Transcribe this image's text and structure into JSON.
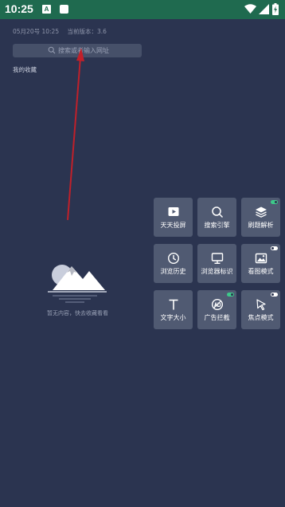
{
  "status_bar": {
    "time": "10:25",
    "notif_a": "A"
  },
  "header": {
    "date_time": "05月20号 10:25",
    "version_label": "当前版本：3.6"
  },
  "search": {
    "placeholder": "搜索或者输入网址"
  },
  "bookmarks": {
    "title": "我的收藏",
    "empty_text": "暂无内容，快去收藏看看"
  },
  "tiles": [
    {
      "label": "天天投屏",
      "icon": "cast-play-icon",
      "toggle": null
    },
    {
      "label": "搜索引擎",
      "icon": "search-icon",
      "toggle": null
    },
    {
      "label": "刷题解析",
      "icon": "layers-icon",
      "toggle": "on"
    },
    {
      "label": "浏览历史",
      "icon": "clock-icon",
      "toggle": null
    },
    {
      "label": "浏览器标识",
      "icon": "monitor-icon",
      "toggle": null
    },
    {
      "label": "看图模式",
      "icon": "image-icon",
      "toggle": "off"
    },
    {
      "label": "文字大小",
      "icon": "text-size-icon",
      "toggle": null
    },
    {
      "label": "广告拦截",
      "icon": "ad-block-icon",
      "toggle": "on"
    },
    {
      "label": "焦点模式",
      "icon": "cursor-icon",
      "toggle": "off"
    }
  ],
  "colors": {
    "background": "#2b3450",
    "status_bar": "#1f6a4f",
    "tile": "#505a72",
    "search_bar": "#465069",
    "toggle_on": "#3ec98a",
    "arrow": "#c0202a"
  }
}
